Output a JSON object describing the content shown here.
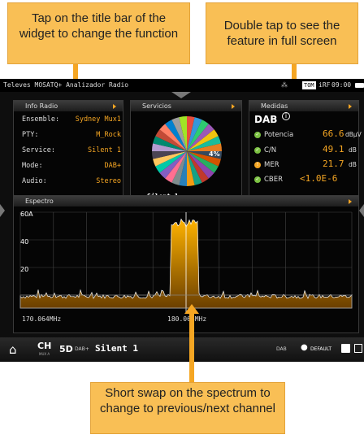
{
  "callouts": {
    "title_bar": "Tap on the title bar of the widget to change the function",
    "full_screen": "Double tap to see the feature in full screen",
    "spectrum": "Short swap on the spectrum to change to previous/next channel"
  },
  "topbar": {
    "left": "Televes MOSATQ+ Analizador Radio",
    "badge": "TOM",
    "rf_label": "iRF",
    "time": "09:00"
  },
  "info_radio": {
    "title": "Info Radio",
    "rows": [
      {
        "label": "Ensemble:",
        "value": "Sydney Mux1"
      },
      {
        "label": "PTY:",
        "value": "M_Rock"
      },
      {
        "label": "Service:",
        "value": "Silent 1"
      },
      {
        "label": "Mode:",
        "value": "DAB+"
      },
      {
        "label": "Audio:",
        "value": "Stereo"
      }
    ]
  },
  "servicios": {
    "title": "Servicios",
    "percent_label": "4%",
    "legend": "Silent 1",
    "colors": [
      "#e74c3c",
      "#3498db",
      "#2ecc71",
      "#9b59b6",
      "#f1c40f",
      "#1abc9c",
      "#e67e22",
      "#34495e",
      "#d35400",
      "#27ae60",
      "#8e44ad",
      "#c0392b",
      "#16a085",
      "#f39c12",
      "#2980b9",
      "#7f8c8d",
      "#ff6f91",
      "#845ec2",
      "#00c9a7",
      "#ffc75f",
      "#4b4453",
      "#b39cd0",
      "#00896f",
      "#c34a36",
      "#ff8066",
      "#0081cf",
      "#9e9e9e",
      "#a0e426"
    ]
  },
  "medidas": {
    "title": "Medidas",
    "standard": "DAB",
    "info_icon": "info-icon",
    "rows": [
      {
        "name": "Potencia",
        "value": "66.6",
        "unit": "dBµV",
        "status": "ok"
      },
      {
        "name": "C/N",
        "value": "49.1",
        "unit": "dB",
        "status": "ok"
      },
      {
        "name": "MER",
        "value": "21.7",
        "unit": "dB",
        "status": "warn"
      },
      {
        "name": "CBER",
        "value": "<1.0E-6",
        "unit": "",
        "status": "ok"
      }
    ]
  },
  "espectro": {
    "title": "Espectro",
    "y_labels": [
      "60A",
      "40",
      "20"
    ],
    "x_left": "170.064MHz",
    "x_center": "180.064MHz"
  },
  "bottombar": {
    "ch_label": "CH",
    "ch_sub": "MUX A",
    "channel": "5D",
    "standard": "DAB+",
    "service": "Silent 1",
    "mode": "DAB",
    "profile": "DEFAULT"
  },
  "colors": {
    "accent": "#f5a623",
    "callout_bg": "#f9bf55"
  }
}
